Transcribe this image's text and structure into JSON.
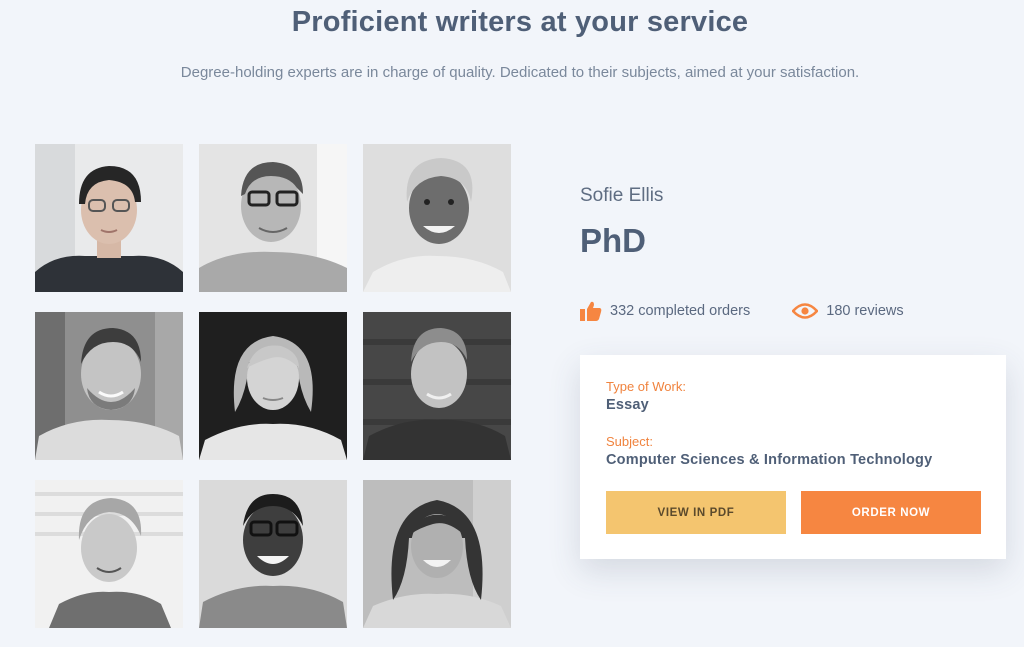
{
  "header": {
    "title": "Proficient writers at your service",
    "subtitle": "Degree-holding experts are in charge of quality. Dedicated to their subjects, aimed at your satisfaction."
  },
  "writers": [
    {
      "photo_name": "writer-photo-1"
    },
    {
      "photo_name": "writer-photo-2"
    },
    {
      "photo_name": "writer-photo-3"
    },
    {
      "photo_name": "writer-photo-4"
    },
    {
      "photo_name": "writer-photo-5"
    },
    {
      "photo_name": "writer-photo-6"
    },
    {
      "photo_name": "writer-photo-7"
    },
    {
      "photo_name": "writer-photo-8"
    },
    {
      "photo_name": "writer-photo-9"
    }
  ],
  "profile": {
    "name": "Sofie Ellis",
    "degree": "PhD",
    "completed_orders": "332 completed orders",
    "reviews": "180 reviews",
    "orders_icon": "thumbs-up-icon",
    "reviews_icon": "eye-icon"
  },
  "card": {
    "type_label": "Type of Work:",
    "type_value": "Essay",
    "subject_label": "Subject:",
    "subject_value": "Computer Sciences & Information Technology",
    "pdf_button": "VIEW IN PDF",
    "order_button": "ORDER NOW"
  },
  "colors": {
    "background": "#f2f5fa",
    "accent_orange": "#f68641",
    "accent_yellow": "#f4c56f",
    "heading": "#4f5f77"
  }
}
